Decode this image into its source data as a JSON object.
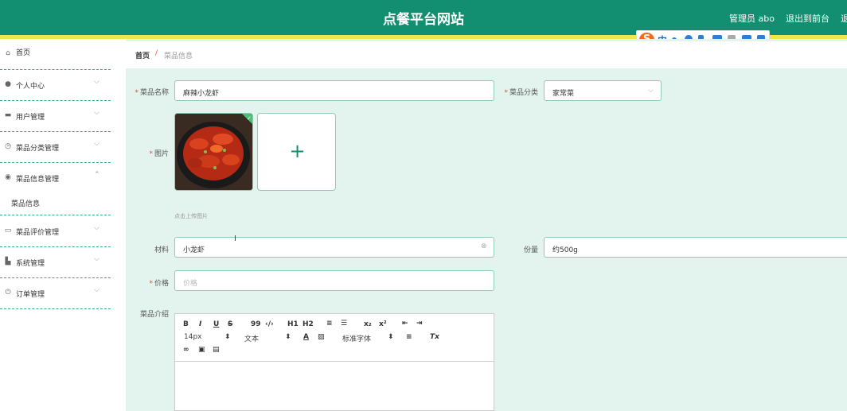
{
  "header": {
    "title": "点餐平台网站",
    "user": "管理员 abo",
    "logout": "退出到前台",
    "extra": "退"
  },
  "ime": {
    "logo": "S",
    "lang": "中"
  },
  "sidebar": {
    "items": [
      {
        "label": "首页",
        "icon": "home-icon",
        "chevron": ""
      },
      {
        "label": "个人中心",
        "icon": "user-icon",
        "chevron": "⌵"
      },
      {
        "label": "用户管理",
        "icon": "monitor-icon",
        "chevron": "⌵"
      },
      {
        "label": "菜品分类管理",
        "icon": "clock-icon",
        "chevron": "⌵"
      },
      {
        "label": "菜品信息管理",
        "icon": "compass-icon",
        "chevron": "⌃"
      },
      {
        "label": "菜品信息",
        "icon": "",
        "chevron": ""
      },
      {
        "label": "菜品评价管理",
        "icon": "card-icon",
        "chevron": "⌵"
      },
      {
        "label": "系统管理",
        "icon": "settings-icon",
        "chevron": "⌵"
      },
      {
        "label": "订单管理",
        "icon": "power-icon",
        "chevron": "⌵"
      }
    ]
  },
  "breadcrumb": {
    "home": "首页",
    "sep": "/",
    "current": "菜品信息"
  },
  "form": {
    "name_label": "菜品名称",
    "name_value": "麻辣小龙虾",
    "category_label": "菜品分类",
    "category_value": "家常菜",
    "image_label": "图片",
    "upload_hint": "点击上传图片",
    "material_label": "材料",
    "material_value": "小龙虾",
    "portion_label": "份量",
    "portion_value": "约500g",
    "price_label": "价格",
    "price_placeholder": "价格",
    "intro_label": "菜品介绍"
  },
  "editor": {
    "row1": [
      "B",
      "I",
      "U",
      "S",
      "99",
      "‹/›",
      "H1",
      "H2",
      "≡",
      "☰",
      "x₂",
      "x²",
      "⇤",
      "⇥"
    ],
    "size": "14px",
    "para": "文本",
    "font": "标准字体",
    "clear_format": "Tx"
  }
}
